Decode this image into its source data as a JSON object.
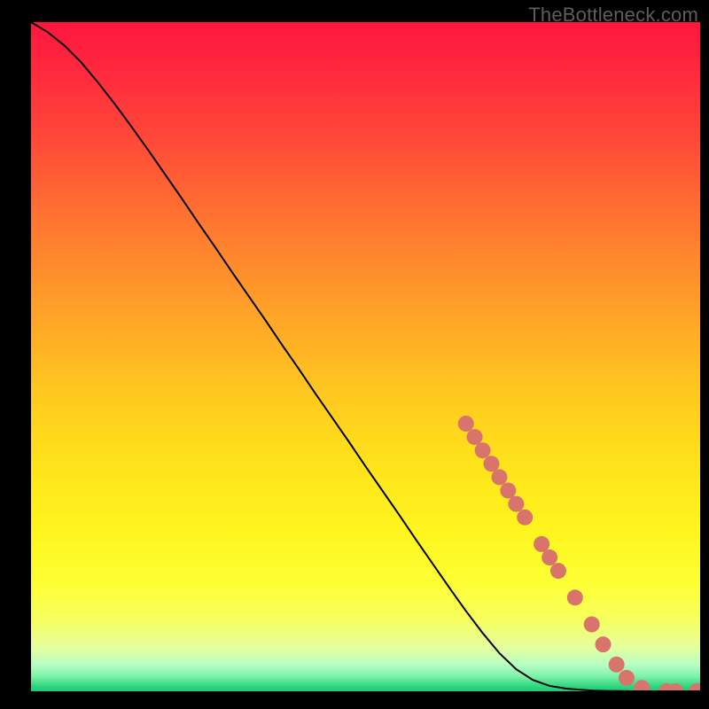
{
  "watermark": "TheBottleneck.com",
  "chart_data": {
    "type": "line",
    "title": "",
    "xlabel": "",
    "ylabel": "",
    "xlim": [
      0,
      100
    ],
    "ylim": [
      0,
      100
    ],
    "curve": {
      "x": [
        0.0,
        2.5,
        5.0,
        7.5,
        10.0,
        12.5,
        15.0,
        17.5,
        20.0,
        22.5,
        25.0,
        27.5,
        30.0,
        32.5,
        35.0,
        37.5,
        40.0,
        42.5,
        45.0,
        47.5,
        50.0,
        52.5,
        55.0,
        57.5,
        60.0,
        62.5,
        65.0,
        67.5,
        70.0,
        72.5,
        75.0,
        77.5,
        80.0,
        82.5,
        84.0,
        86.0,
        88.0,
        90.0,
        100.0
      ],
      "y": [
        100.0,
        98.5,
        96.5,
        94.0,
        91.0,
        87.8,
        84.4,
        80.9,
        77.3,
        73.7,
        70.0,
        66.4,
        62.7,
        59.1,
        55.5,
        51.8,
        48.2,
        44.5,
        40.9,
        37.3,
        33.6,
        30.0,
        26.4,
        22.7,
        19.1,
        15.5,
        12.0,
        8.7,
        5.7,
        3.3,
        1.7,
        0.8,
        0.4,
        0.2,
        0.1,
        0.05,
        0.03,
        0.0,
        0.0
      ]
    },
    "markers": [
      {
        "x": 65.0,
        "y": 40.0
      },
      {
        "x": 66.3,
        "y": 38.0
      },
      {
        "x": 67.5,
        "y": 36.0
      },
      {
        "x": 68.8,
        "y": 34.0
      },
      {
        "x": 70.0,
        "y": 32.0
      },
      {
        "x": 71.3,
        "y": 30.0
      },
      {
        "x": 72.5,
        "y": 28.0
      },
      {
        "x": 73.8,
        "y": 26.0
      },
      {
        "x": 76.3,
        "y": 22.0
      },
      {
        "x": 77.5,
        "y": 20.0
      },
      {
        "x": 78.8,
        "y": 18.0
      },
      {
        "x": 81.3,
        "y": 14.0
      },
      {
        "x": 83.8,
        "y": 10.0
      },
      {
        "x": 85.5,
        "y": 7.0
      },
      {
        "x": 87.5,
        "y": 4.0
      },
      {
        "x": 89.0,
        "y": 2.0
      },
      {
        "x": 91.3,
        "y": 0.5
      },
      {
        "x": 95.0,
        "y": 0.0
      },
      {
        "x": 96.3,
        "y": 0.0
      },
      {
        "x": 99.5,
        "y": 0.0
      },
      {
        "x": 100.0,
        "y": 0.0
      }
    ],
    "gradient_stops": [
      {
        "offset": 0.0,
        "color": "#ff163e"
      },
      {
        "offset": 0.08,
        "color": "#ff2b3d"
      },
      {
        "offset": 0.18,
        "color": "#ff4a38"
      },
      {
        "offset": 0.3,
        "color": "#ff7630"
      },
      {
        "offset": 0.42,
        "color": "#ff9e29"
      },
      {
        "offset": 0.55,
        "color": "#ffc71f"
      },
      {
        "offset": 0.66,
        "color": "#ffe31b"
      },
      {
        "offset": 0.76,
        "color": "#fff51e"
      },
      {
        "offset": 0.84,
        "color": "#fdff35"
      },
      {
        "offset": 0.895,
        "color": "#f6ff60"
      },
      {
        "offset": 0.935,
        "color": "#e4ffa0"
      },
      {
        "offset": 0.96,
        "color": "#b8ffc3"
      },
      {
        "offset": 0.978,
        "color": "#7cf2a8"
      },
      {
        "offset": 0.992,
        "color": "#31d681"
      },
      {
        "offset": 1.0,
        "color": "#1ec973"
      }
    ],
    "marker_color": "#d8746c",
    "curve_color": "#000000"
  }
}
